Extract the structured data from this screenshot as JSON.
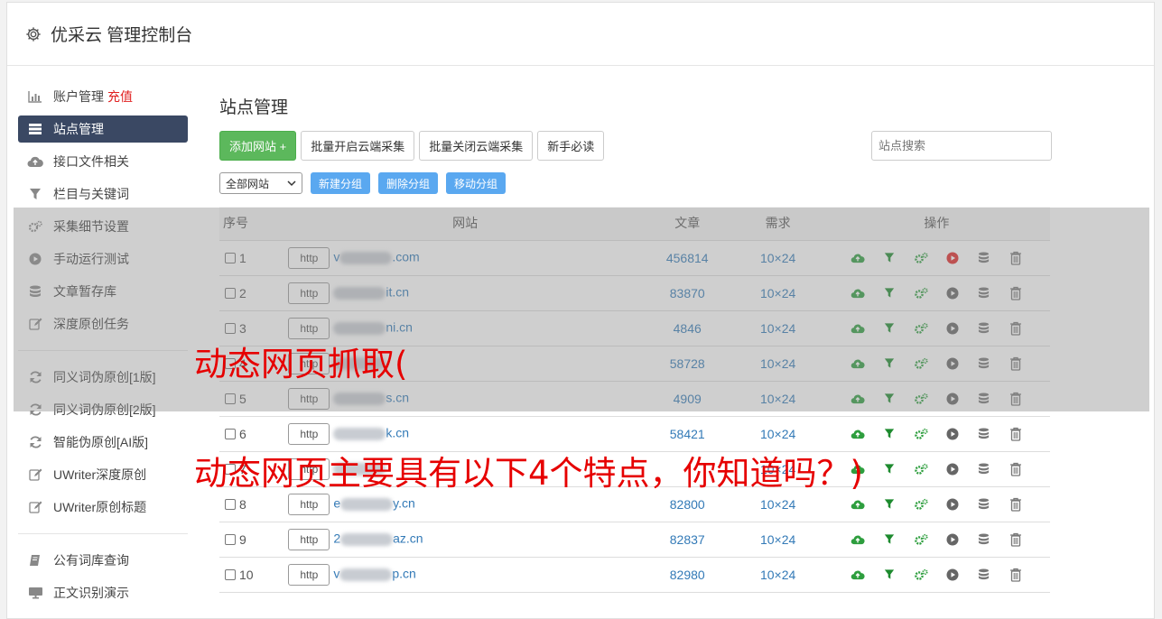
{
  "app": {
    "title": "优采云 管理控制台"
  },
  "sidebar": {
    "group1": [
      {
        "label": "账户管理",
        "icon": "bar-chart-icon",
        "extra": "充值"
      },
      {
        "label": "站点管理",
        "icon": "server-list-icon",
        "active": true
      },
      {
        "label": "接口文件相关",
        "icon": "cloud-upload-icon"
      },
      {
        "label": "栏目与关键词",
        "icon": "filter-icon"
      },
      {
        "label": "采集细节设置",
        "icon": "gears-icon"
      },
      {
        "label": "手动运行测试",
        "icon": "play-circle-icon"
      },
      {
        "label": "文章暂存库",
        "icon": "database-icon"
      },
      {
        "label": "深度原创任务",
        "icon": "edit-icon"
      }
    ],
    "group2": [
      {
        "label": "同义词伪原创[1版]",
        "icon": "refresh-icon"
      },
      {
        "label": "同义词伪原创[2版]",
        "icon": "refresh-icon"
      },
      {
        "label": "智能伪原创[AI版]",
        "icon": "refresh-icon"
      },
      {
        "label": "UWriter深度原创",
        "icon": "edit-icon"
      },
      {
        "label": "UWriter原创标题",
        "icon": "edit-icon"
      }
    ],
    "group3": [
      {
        "label": "公有词库查询",
        "icon": "book-icon"
      },
      {
        "label": "正文识别演示",
        "icon": "monitor-icon"
      }
    ]
  },
  "main": {
    "title": "站点管理",
    "buttons": {
      "add": "添加网站 +",
      "batch_open": "批量开启云端采集",
      "batch_close": "批量关闭云端采集",
      "guide": "新手必读"
    },
    "search_placeholder": "站点搜索",
    "group_select": "全部网站",
    "group_buttons": {
      "new": "新建分组",
      "delete": "删除分组",
      "move": "移动分组"
    },
    "table": {
      "headers": [
        "序号",
        "网站",
        "文章",
        "需求",
        "操作"
      ],
      "http_label": "http",
      "rows": [
        {
          "no": "1",
          "prefix": "v",
          "suffix": ".com",
          "articles": "456814",
          "demand": "10×24",
          "running": true
        },
        {
          "no": "2",
          "prefix": "",
          "suffix": "it.cn",
          "articles": "83870",
          "demand": "10×24"
        },
        {
          "no": "3",
          "prefix": "",
          "suffix": "ni.cn",
          "articles": "4846",
          "demand": "10×24"
        },
        {
          "no": "4",
          "prefix": "",
          "suffix": "",
          "articles": "58728",
          "demand": "10×24"
        },
        {
          "no": "5",
          "prefix": "",
          "suffix": "s.cn",
          "articles": "4909",
          "demand": "10×24"
        },
        {
          "no": "6",
          "prefix": "",
          "suffix": "k.cn",
          "articles": "58421",
          "demand": "10×24"
        },
        {
          "no": "7",
          "prefix": "",
          "suffix": "",
          "articles": "",
          "demand": "10×24"
        },
        {
          "no": "8",
          "prefix": "e",
          "suffix": "y.cn",
          "articles": "82800",
          "demand": "10×24"
        },
        {
          "no": "9",
          "prefix": "2",
          "suffix": "az.cn",
          "articles": "82837",
          "demand": "10×24"
        },
        {
          "no": "10",
          "prefix": "v",
          "suffix": "p.cn",
          "articles": "82980",
          "demand": "10×24"
        }
      ]
    }
  },
  "overlay": {
    "line1": "动态网页抓取(",
    "line2": "动态网页主要具有以下4个特点，你知道吗？)"
  },
  "colors": {
    "accent_active": "#3a4863",
    "green": "#5cb85c",
    "link": "#337ab7",
    "blue_btn": "#5aa8f0",
    "caption": "#e60000"
  }
}
